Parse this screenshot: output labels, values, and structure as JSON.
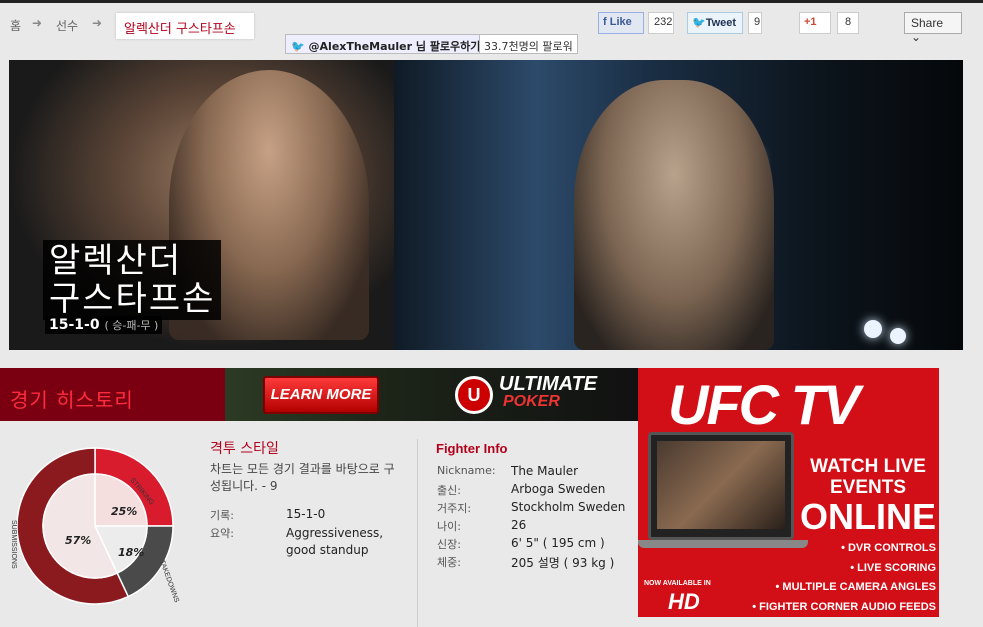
{
  "breadcrumb": {
    "home": "홈",
    "fighters": "선수",
    "current": "알렉산더 구스타프손"
  },
  "social": {
    "like_label": "Like",
    "like_count": "232",
    "tweet_label": "Tweet",
    "tweet_count": "9",
    "gplus_label": "+1",
    "gplus_count": "8",
    "share_label": "Share",
    "follow_label": "@AlexTheMauler 님 팔로우하기",
    "follower_count": "33.7천명의 팔로워"
  },
  "hero": {
    "name_line1": "알렉산더",
    "name_line2": "구스타프손",
    "record": "15-1-0",
    "record_note": "( 승-패-무 )"
  },
  "history": {
    "title": "경기 히스토리"
  },
  "poker_ad": {
    "button": "LEARN MORE",
    "logo_letter": "U",
    "logo_main": "ULTIMATE",
    "logo_sub": "POKER"
  },
  "ufctv_ad": {
    "logo": "UFC TV",
    "watch_line1": "WATCH LIVE",
    "watch_line2": "EVENTS",
    "watch_line3": "ONLINE",
    "available": "NOW AVAILABLE IN",
    "hd": "HD",
    "features": [
      "• DVR CONTROLS",
      "• LIVE SCORING",
      "• MULTIPLE CAMERA ANGLES",
      "• FIGHTER CORNER AUDIO FEEDS"
    ]
  },
  "fight_style": {
    "title": "격투 스타일",
    "description": "차트는 모든 경기 결과를 바탕으로 구성됩니다. - 9",
    "record_label": "기록:",
    "record_value": "15-1-0",
    "summary_label": "요약:",
    "summary_value": "Aggressiveness, good standup"
  },
  "chart_data": {
    "type": "pie",
    "categories": [
      "STRIKING",
      "TAKEDOWNS",
      "SUBMISSIONS"
    ],
    "values": [
      25,
      18,
      57
    ],
    "labels": [
      "25%",
      "18%",
      "57%"
    ],
    "colors": [
      "#d81c2e",
      "#4a4a4a",
      "#8b1a1e"
    ]
  },
  "fighter_info": {
    "title": "Fighter Info",
    "rows": [
      {
        "label": "Nickname:",
        "value": "The Mauler"
      },
      {
        "label": "출신:",
        "value": "Arboga Sweden"
      },
      {
        "label": "거주지:",
        "value": "Stockholm Sweden"
      },
      {
        "label": "나이:",
        "value": "26"
      },
      {
        "label": "신장:",
        "value": "6' 5\" ( 195 cm )"
      },
      {
        "label": "체중:",
        "value": "205 설명 ( 93 kg )"
      }
    ]
  }
}
